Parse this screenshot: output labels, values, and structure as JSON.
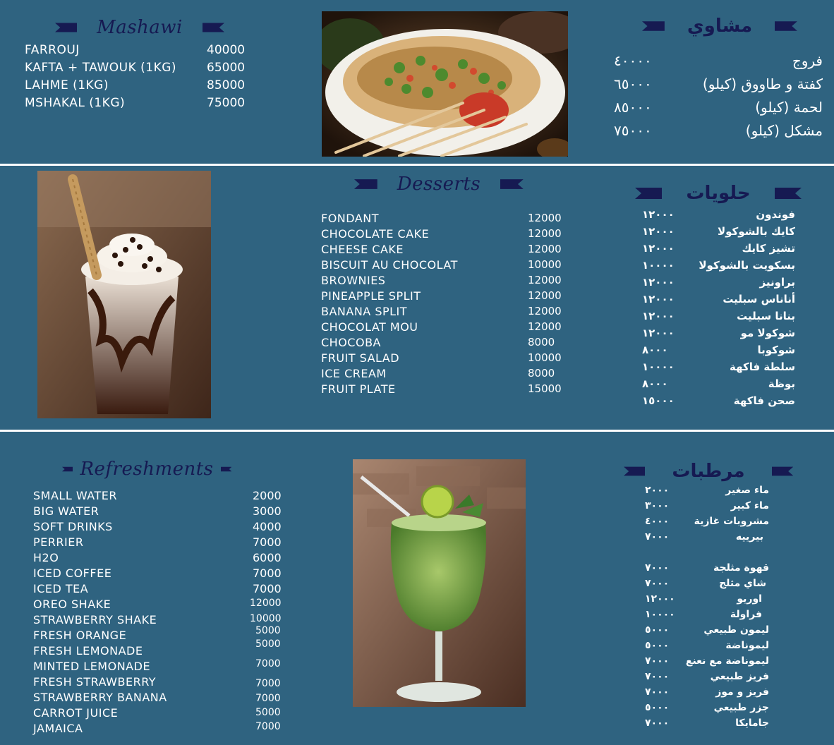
{
  "colors": {
    "background": "#2f6380",
    "heading": "#161a52",
    "text": "#ffffff"
  },
  "mashawi": {
    "title_en": "Mashawi",
    "title_ar": "مشاوي",
    "items_en": [
      {
        "name": "FARROUJ",
        "price": "40000"
      },
      {
        "name": "KAFTA + TAWOUK (1KG)",
        "price": "65000"
      },
      {
        "name": "LAHME (1KG)",
        "price": "85000"
      },
      {
        "name": "MSHAKAL (1KG)",
        "price": "75000"
      }
    ],
    "items_ar": [
      {
        "name": "فروج",
        "price": "٤٠٠٠٠"
      },
      {
        "name": "كفتة و طاووق (كيلو)",
        "price": "٦٥٠٠٠"
      },
      {
        "name": "لحمة (كيلو)",
        "price": "٨٥٠٠٠"
      },
      {
        "name": "مشكل (كيلو)",
        "price": "٧٥٠٠٠"
      }
    ]
  },
  "desserts": {
    "title_en": "Desserts",
    "title_ar": "حلويات",
    "items_en": [
      {
        "name": "FONDANT",
        "price": "12000"
      },
      {
        "name": "CHOCOLATE CAKE",
        "price": "12000"
      },
      {
        "name": "CHEESE CAKE",
        "price": "12000"
      },
      {
        "name": "BISCUIT AU CHOCOLAT",
        "price": "10000"
      },
      {
        "name": "BROWNIES",
        "price": "12000"
      },
      {
        "name": "PINEAPPLE SPLIT",
        "price": "12000"
      },
      {
        "name": "BANANA SPLIT",
        "price": "12000"
      },
      {
        "name": "CHOCOLAT MOU",
        "price": "12000"
      },
      {
        "name": "CHOCOBA",
        "price": "8000"
      },
      {
        "name": "FRUIT SALAD",
        "price": "10000"
      },
      {
        "name": "ICE CREAM",
        "price": "8000"
      },
      {
        "name": "FRUIT PLATE",
        "price": "15000"
      }
    ],
    "items_ar": [
      {
        "name": "فوندون",
        "price": "١٢٠٠٠"
      },
      {
        "name": "كايك بالشوكولا",
        "price": "١٢٠٠٠"
      },
      {
        "name": "تشيز كايك",
        "price": "١٢٠٠٠"
      },
      {
        "name": "بسكويت بالشوكولا",
        "price": "١٠٠٠٠"
      },
      {
        "name": "براونيز",
        "price": "١٢٠٠٠"
      },
      {
        "name": "أناناس سبليت",
        "price": "١٢٠٠٠"
      },
      {
        "name": "بنانا سبليت",
        "price": "١٢٠٠٠"
      },
      {
        "name": "شوكولا مو",
        "price": "١٢٠٠٠"
      },
      {
        "name": "شوكوبا",
        "price": "٨٠٠٠"
      },
      {
        "name": "سلطة فاكهة",
        "price": "١٠٠٠٠"
      },
      {
        "name": "بوظة",
        "price": "٨٠٠٠"
      },
      {
        "name": "صحن فاكهة",
        "price": "١٥٠٠٠"
      }
    ]
  },
  "refreshments": {
    "title_en": "Refreshments",
    "title_ar": "مرطبات",
    "items_en": [
      {
        "name": "SMALL WATER",
        "price": "2000"
      },
      {
        "name": "BIG WATER",
        "price": "3000"
      },
      {
        "name": "SOFT DRINKS",
        "price": "4000"
      },
      {
        "name": "PERRIER",
        "price": "7000"
      },
      {
        "name": "H2O",
        "price": "6000"
      },
      {
        "name": "ICED COFFEE",
        "price": "7000"
      },
      {
        "name": "ICED TEA",
        "price": "7000"
      },
      {
        "name": "OREO SHAKE",
        "price": "12000"
      },
      {
        "name": "STRAWBERRY SHAKE",
        "price": "10000"
      },
      {
        "name": "FRESH ORANGE",
        "price": "5000"
      },
      {
        "name": "FRESH LEMONADE",
        "price": "5000"
      },
      {
        "name": "MINTED LEMONADE",
        "price": "7000"
      },
      {
        "name": "FRESH STRAWBERRY",
        "price": "7000"
      },
      {
        "name": "STRAWBERRY BANANA",
        "price": "7000"
      },
      {
        "name": "CARROT JUICE",
        "price": "5000"
      },
      {
        "name": "JAMAICA",
        "price": "7000"
      }
    ],
    "items_ar": [
      {
        "name": "ماء صغير",
        "price": "٢٠٠٠"
      },
      {
        "name": "ماء كبير",
        "price": "٣٠٠٠"
      },
      {
        "name": "مشروبات غازية",
        "price": "٤٠٠٠"
      },
      {
        "name": "بيرييه",
        "price": "٧٠٠٠"
      },
      {
        "name": "قهوة مثلجة",
        "price": "٧٠٠٠"
      },
      {
        "name": "شاي مثلج",
        "price": "٧٠٠٠"
      },
      {
        "name": "اوريو",
        "price": "١٢٠٠٠"
      },
      {
        "name": "فراولة",
        "price": "١٠٠٠٠"
      },
      {
        "name": "ليمون طبيعي",
        "price": "٥٠٠٠"
      },
      {
        "name": "ليموناضة",
        "price": "٥٠٠٠"
      },
      {
        "name": "ليموناضة مع نعنع",
        "price": "٧٠٠٠"
      },
      {
        "name": "فريز طبيعي",
        "price": "٧٠٠٠"
      },
      {
        "name": "فريز و موز",
        "price": "٧٠٠٠"
      },
      {
        "name": "جزر طبيعي",
        "price": "٥٠٠٠"
      },
      {
        "name": "جامايكا",
        "price": "٧٠٠٠"
      }
    ]
  }
}
